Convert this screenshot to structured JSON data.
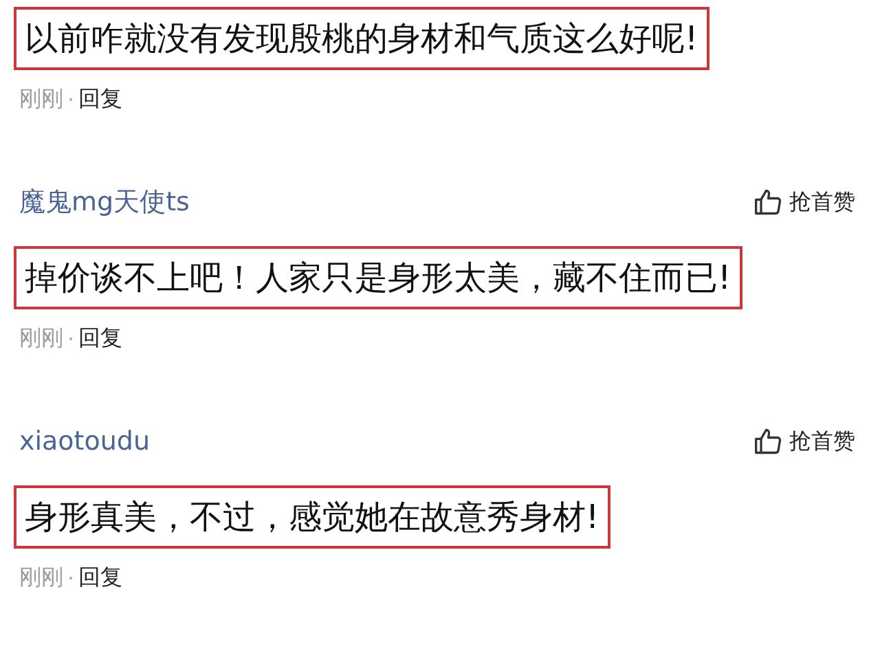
{
  "comments": [
    {
      "text": "以前咋就没有发现殷桃的身材和气质这么好呢!",
      "highlighted": true,
      "time": "刚刚",
      "separator": "·",
      "reply": "回复"
    },
    {
      "user": "魔鬼mg天使ts",
      "like_label": "抢首赞",
      "text": "掉价谈不上吧！人家只是身形太美，藏不住而已!",
      "highlighted": true,
      "time": "刚刚",
      "separator": "·",
      "reply": "回复"
    },
    {
      "user": "xiaotoudu",
      "like_label": "抢首赞",
      "text": "身形真美，不过，感觉她在故意秀身材!",
      "highlighted": true,
      "time": "刚刚",
      "separator": "·",
      "reply": "回复"
    }
  ]
}
